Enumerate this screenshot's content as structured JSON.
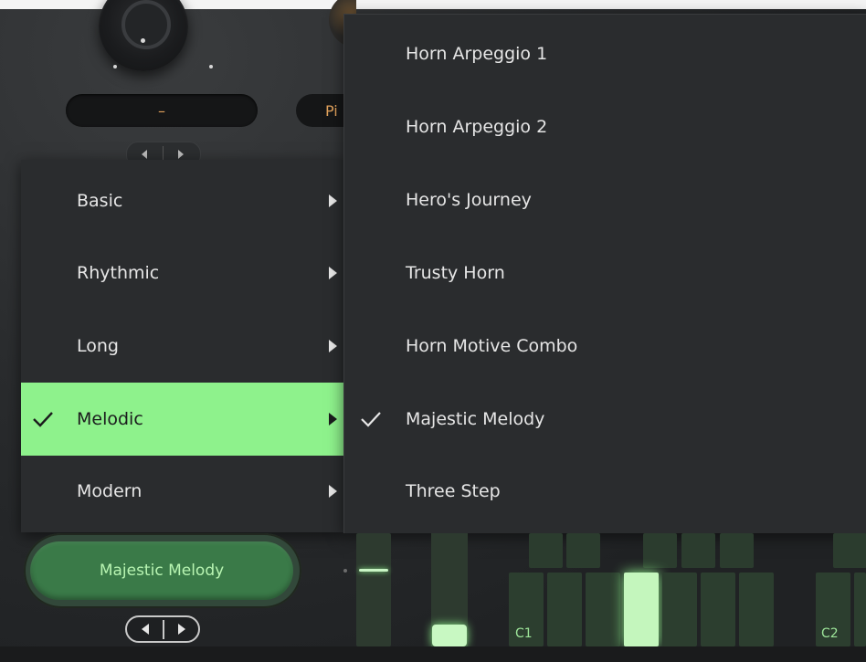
{
  "header": {
    "value_field_1": "–",
    "value_field_2": "Pi"
  },
  "category_menu": {
    "items": [
      {
        "label": "Basic",
        "selected": false
      },
      {
        "label": "Rhythmic",
        "selected": false
      },
      {
        "label": "Long",
        "selected": false
      },
      {
        "label": "Melodic",
        "selected": true
      },
      {
        "label": "Modern",
        "selected": false
      }
    ]
  },
  "preset_menu": {
    "items": [
      {
        "label": "Horn Arpeggio 1",
        "selected": false
      },
      {
        "label": "Horn Arpeggio 2",
        "selected": false
      },
      {
        "label": "Hero's Journey",
        "selected": false
      },
      {
        "label": "Trusty Horn",
        "selected": false
      },
      {
        "label": "Horn Motive Combo",
        "selected": false
      },
      {
        "label": "Majestic Melody",
        "selected": true
      },
      {
        "label": "Three Step",
        "selected": false
      }
    ]
  },
  "preset_selector": {
    "current": "Majestic Melody"
  },
  "keyboard": {
    "labels": [
      "C1",
      "C2"
    ],
    "active_key": "E1"
  },
  "colors": {
    "accent": "#8ef28c",
    "menu_bg": "#2a2c2e",
    "value_text": "#e2a25c"
  }
}
